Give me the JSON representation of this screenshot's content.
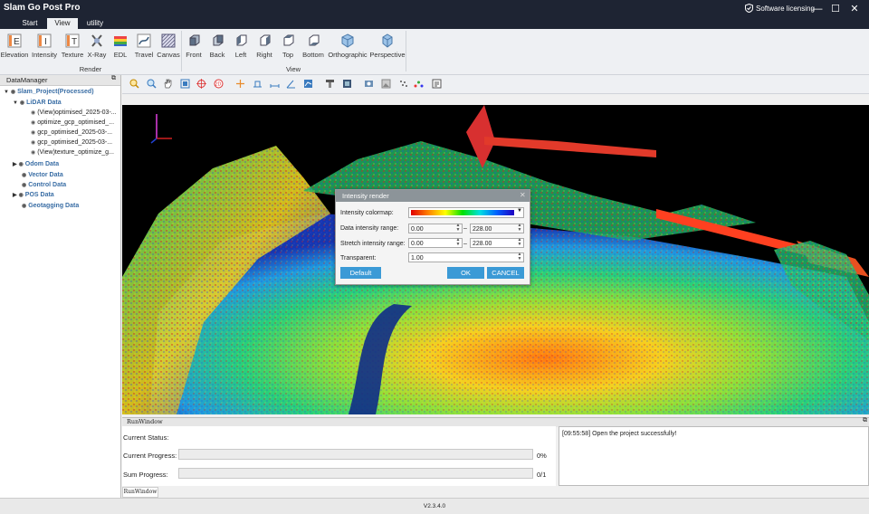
{
  "app": {
    "title": "Slam Go Post Pro",
    "licensing": "Software licensing"
  },
  "tabs": [
    {
      "label": "Start"
    },
    {
      "label": "View"
    },
    {
      "label": "utility"
    }
  ],
  "ribbon": {
    "render_buttons": [
      {
        "label": "Elevation",
        "icon": "elevation-icon"
      },
      {
        "label": "Intensity",
        "icon": "intensity-icon"
      },
      {
        "label": "Texture",
        "icon": "texture-icon"
      },
      {
        "label": "X-Ray",
        "icon": "xray-icon"
      },
      {
        "label": "EDL",
        "icon": "edl-icon"
      },
      {
        "label": "Travel",
        "icon": "travel-icon"
      },
      {
        "label": "Canvas",
        "icon": "canvas-icon"
      }
    ],
    "render_group": "Render",
    "view_buttons": [
      {
        "label": "Front",
        "icon": "front-view-icon"
      },
      {
        "label": "Back",
        "icon": "back-view-icon"
      },
      {
        "label": "Left",
        "icon": "left-view-icon"
      },
      {
        "label": "Right",
        "icon": "right-view-icon"
      },
      {
        "label": "Top",
        "icon": "top-view-icon"
      },
      {
        "label": "Bottom",
        "icon": "bottom-view-icon"
      },
      {
        "label": "Orthographic",
        "icon": "orthographic-icon"
      },
      {
        "label": "Perspective",
        "icon": "perspective-icon"
      }
    ],
    "view_group": "View"
  },
  "data_manager": {
    "title": "DataManager",
    "project": "Slam_Project(Processed)",
    "lidar": "LiDAR Data",
    "files": [
      "(View)optimised_2025-03-...",
      "optimize_gcp_optimised_...",
      "gcp_optimised_2025-03-...",
      "gcp_optimised_2025-03-...",
      "(View)texture_optimize_g..."
    ],
    "groups": [
      "Odom Data",
      "Vector Data",
      "Control Data",
      "POS Data",
      "Geotagging Data"
    ]
  },
  "dialog": {
    "title": "Intensity render",
    "colormap_label": "Intensity colormap:",
    "data_range_label": "Data intensity range:",
    "data_min": "0.00",
    "data_max": "228.00",
    "stretch_label": "Stretch intensity range:",
    "stretch_min": "0.00",
    "stretch_max": "228.00",
    "transparent_label": "Transparent:",
    "transparent_value": "1.00",
    "dash": "–",
    "default_btn": "Default",
    "ok_btn": "OK",
    "cancel_btn": "CANCEL"
  },
  "run_window": {
    "title": "RunWindow",
    "current_status_label": "Current Status:",
    "current_progress_label": "Current Progress:",
    "current_progress_value": "0%",
    "current_progress_fraction": 0,
    "sum_progress_label": "Sum Progress:",
    "sum_progress_value": "0/1",
    "sum_progress_fraction": 0,
    "log": "[09:55:58] Open the project successfully!",
    "tab": "RunWindow"
  },
  "status_bar": {
    "version": "V2.3.4.0"
  },
  "colors": {
    "titlebar": "#1e2433",
    "accent": "#3b9ad6",
    "tree_blue": "#3a6ea5"
  }
}
